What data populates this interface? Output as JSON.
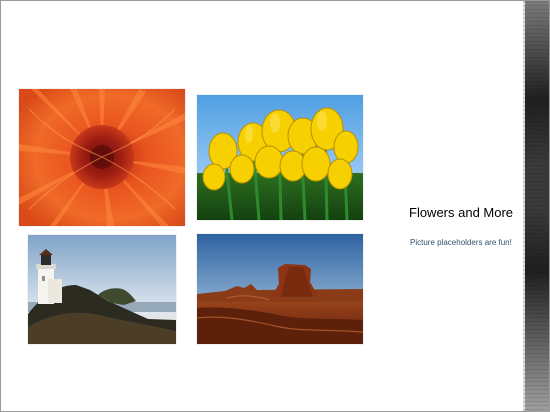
{
  "slide": {
    "title": "Flowers and More",
    "subtitle": "Picture placeholders are fun!"
  },
  "photos": [
    {
      "name": "orange-dahlia-photo"
    },
    {
      "name": "yellow-tulips-photo"
    },
    {
      "name": "lighthouse-photo"
    },
    {
      "name": "desert-mesa-photo"
    }
  ],
  "colors": {
    "background": "#ffffff",
    "title": "#000000",
    "subtitle": "#2f4f6f",
    "edge_texture": "#3a3a3a"
  }
}
